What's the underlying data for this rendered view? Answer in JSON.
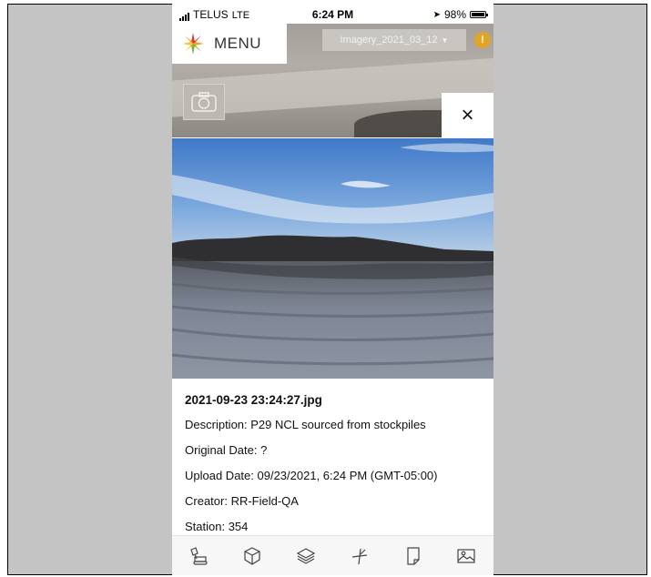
{
  "status_bar": {
    "carrier": "TELUS",
    "network": "LTE",
    "time": "6:24 PM",
    "battery": "98%"
  },
  "header": {
    "menu_label": "MENU",
    "imagery_select": "Imagery_2021_03_12",
    "alert_symbol": "!"
  },
  "icons": {
    "logo": "compass-star-logo",
    "camera": "camera-icon",
    "close": "close-icon",
    "close_glyph": "×",
    "dropdown": "chevron-down-icon"
  },
  "photo_details": {
    "filename": "2021-09-23 23:24:27.jpg",
    "description": "Description: P29 NCL sourced from stockpiles",
    "original_date": "Original Date: ?",
    "upload_date": "Upload Date: 09/23/2021, 6:24 PM (GMT-05:00)",
    "creator": "Creator: RR-Field-QA",
    "station": "Station: 354"
  },
  "toolbar": {
    "items": [
      {
        "icon": "excavator-icon"
      },
      {
        "icon": "cube-icon"
      },
      {
        "icon": "layers-icon"
      },
      {
        "icon": "measure-icon"
      },
      {
        "icon": "document-icon"
      },
      {
        "icon": "image-icon"
      }
    ]
  },
  "colors": {
    "alert": "#e0a526",
    "logo_red": "#d8402a",
    "logo_orange": "#f0a22b",
    "logo_green": "#7fb13a",
    "logo_yellow": "#f4c73a"
  }
}
